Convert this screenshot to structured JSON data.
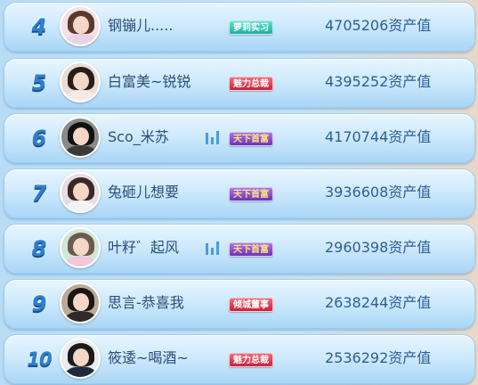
{
  "leaderboard": {
    "rows": [
      {
        "rank": "4",
        "name": "钢镚儿.....",
        "badge": "萝莉实习",
        "badge_color": "#1fae9f",
        "assets": "4705206资产值",
        "playing": false,
        "avatar": {
          "hair": "#5b3a2e",
          "body": "#e9d3e6",
          "bg": "#f2e1e7"
        }
      },
      {
        "rank": "5",
        "name": "白富美~锐锐",
        "badge": "魅力总裁",
        "badge_color": "#c8213c",
        "assets": "4395252资产值",
        "playing": false,
        "avatar": {
          "hair": "#2a1c18",
          "body": "#f4e9e4",
          "bg": "#e8dcd6"
        }
      },
      {
        "rank": "6",
        "name": "Sco_米苏",
        "badge": "天下首富",
        "badge_color": "#6a33b8",
        "assets": "4170744资产值",
        "playing": true,
        "avatar": {
          "hair": "#111111",
          "body": "#3a3a3a",
          "bg": "#8a8a8a"
        }
      },
      {
        "rank": "7",
        "name": "兔砸儿想要",
        "badge": "天下首富",
        "badge_color": "#6a33b8",
        "assets": "3936608资产值",
        "playing": false,
        "avatar": {
          "hair": "#3b2a24",
          "body": "#f3f3f3",
          "bg": "#e4dde4"
        }
      },
      {
        "rank": "8",
        "name": "叶籽゛起风",
        "badge": "天下首富",
        "badge_color": "#6a33b8",
        "assets": "2960398资产值",
        "playing": true,
        "avatar": {
          "hair": "#6b5a4e",
          "body": "#f0c8d8",
          "bg": "#cfe8d5"
        }
      },
      {
        "rank": "9",
        "name": "思言-恭喜我",
        "badge": "倾城董事",
        "badge_color": "#c8213c",
        "assets": "2638244资产值",
        "playing": false,
        "avatar": {
          "hair": "#1e1612",
          "body": "#2e2a2a",
          "bg": "#b7ac98"
        }
      },
      {
        "rank": "10",
        "name": "筱逶~喝酒~",
        "badge": "魅力总裁",
        "badge_color": "#c8213c",
        "assets": "2536292资产值",
        "playing": false,
        "avatar": {
          "hair": "#1a1a1a",
          "body": "#1e2a3a",
          "bg": "#e9ecef"
        }
      }
    ]
  }
}
